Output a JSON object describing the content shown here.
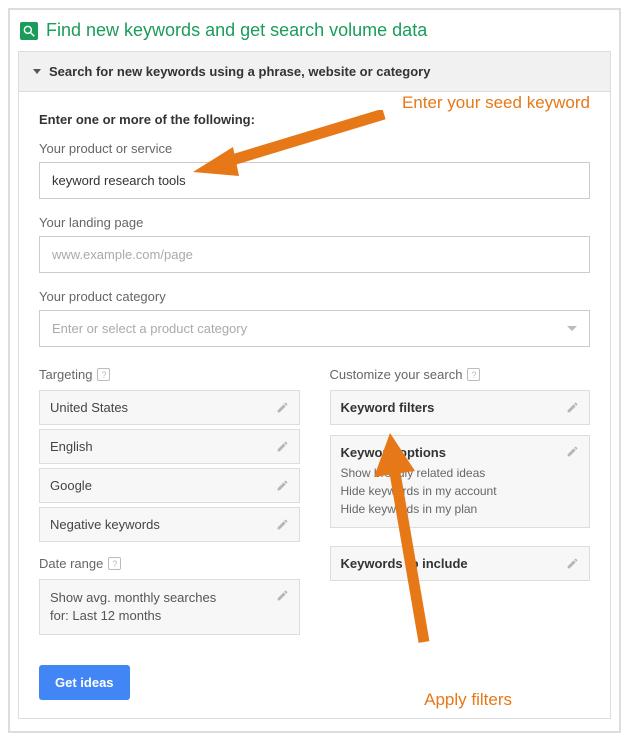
{
  "title": "Find new keywords and get search volume data",
  "accordion_title": "Search for new keywords using a phrase, website or category",
  "section_label": "Enter one or more of the following:",
  "product_label": "Your product or service",
  "product_value": "keyword research tools",
  "landing_label": "Your landing page",
  "landing_placeholder": "www.example.com/page",
  "category_label": "Your product category",
  "category_placeholder": "Enter or select a product category",
  "targeting_label": "Targeting",
  "targeting_items": [
    "United States",
    "English",
    "Google",
    "Negative keywords"
  ],
  "customize_label": "Customize your search",
  "keyword_filters": "Keyword filters",
  "keyword_options_title": "Keyword options",
  "keyword_options_lines": [
    "Show broadly related ideas",
    "Hide keywords in my account",
    "Hide keywords in my plan"
  ],
  "keywords_include": "Keywords to include",
  "daterange_label": "Date range",
  "daterange_text": "Show avg. monthly searches for: Last 12 months",
  "get_ideas": "Get ideas",
  "annot1": "Enter your seed keyword",
  "annot2": "Apply filters"
}
